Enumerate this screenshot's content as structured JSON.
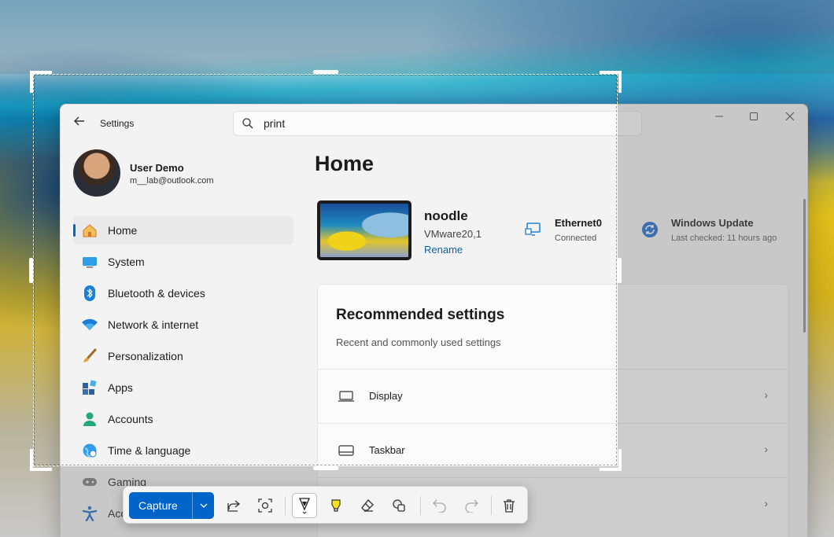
{
  "window": {
    "title": "Settings",
    "search_value": "print"
  },
  "profile": {
    "name": "User Demo",
    "email": "m__lab@outlook.com"
  },
  "nav": {
    "items": [
      {
        "label": "Home",
        "icon": "home-icon",
        "active": true
      },
      {
        "label": "System",
        "icon": "system-icon"
      },
      {
        "label": "Bluetooth & devices",
        "icon": "bluetooth-icon"
      },
      {
        "label": "Network & internet",
        "icon": "wifi-icon"
      },
      {
        "label": "Personalization",
        "icon": "brush-icon"
      },
      {
        "label": "Apps",
        "icon": "apps-icon"
      },
      {
        "label": "Accounts",
        "icon": "accounts-icon"
      },
      {
        "label": "Time & language",
        "icon": "globe-icon"
      },
      {
        "label": "Gaming",
        "icon": "gamepad-icon"
      },
      {
        "label": "Acc",
        "icon": "accessibility-icon"
      }
    ]
  },
  "main": {
    "page_title": "Home",
    "device": {
      "name": "noodle",
      "model": "VMware20,1",
      "rename_label": "Rename"
    },
    "network_status": {
      "title": "Ethernet0",
      "subtitle": "Connected"
    },
    "update_status": {
      "title": "Windows Update",
      "subtitle": "Last checked: 11 hours ago"
    },
    "recommended": {
      "title": "Recommended settings",
      "subtitle": "Recent and commonly used settings",
      "rows": [
        {
          "label": "Display",
          "icon": "display-icon"
        },
        {
          "label": "Taskbar",
          "icon": "taskbar-icon"
        },
        {
          "label": "",
          "icon": ""
        }
      ]
    }
  },
  "snip_toolbar": {
    "capture_label": "Capture",
    "tools": [
      "share-icon",
      "visual-search-icon",
      "pen-icon",
      "highlighter-icon",
      "eraser-icon",
      "shapes-icon",
      "undo-icon",
      "redo-icon",
      "delete-icon"
    ]
  },
  "colors": {
    "accent": "#0064c8",
    "link": "#0f5fb0"
  }
}
